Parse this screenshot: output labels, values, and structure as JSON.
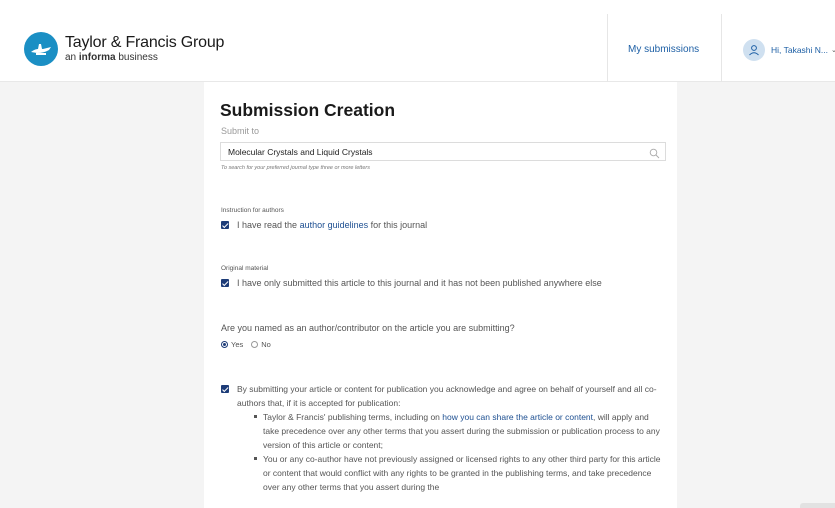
{
  "header": {
    "brand_name": "Taylor & Francis Group",
    "brand_sub_prefix": "an",
    "brand_sub_bold": "informa",
    "brand_sub_suffix": "business",
    "my_submissions": "My submissions",
    "user_greeting": "Hi, Takashi N...",
    "user_chevron": "⌄"
  },
  "form": {
    "title": "Submission Creation",
    "submit_to_label": "Submit to",
    "journal_value": "Molecular Crystals and Liquid Crystals",
    "journal_hint": "To search for your preferred journal type three or more letters",
    "instructions_label": "Instruction for authors",
    "guidelines_pre": "I have read the",
    "guidelines_link": "author guidelines",
    "guidelines_post": "for this journal",
    "original_label": "Original material",
    "original_text": "I have only submitted this article to this journal and it has not been published anywhere else",
    "author_question": "Are you named as an author/contributor on the article you are submitting?",
    "author_options": [
      "Yes",
      "No"
    ],
    "author_selected": "Yes",
    "consent_main": "By submitting your article or content for publication you acknowledge and agree on behalf of yourself and all co-authors that, if it is accepted for publication:",
    "bullet1_pre": "Taylor & Francis' publishing terms, including on",
    "bullet1_link": "how you can share the article or content",
    "bullet1_post": ", will apply and take precedence over any other terms that you assert during the submission or publication process to any version of this article or content;",
    "bullet2": "You or any co-author have not previously assigned or licensed rights to any other third party for this article or content that would conflict with any rights to be granted in the publishing terms, and take precedence over any other terms that you assert during the"
  },
  "icons": {
    "logo": "taylor-francis-lamp-logo",
    "search": "search-icon",
    "user": "user-icon"
  },
  "colors": {
    "brand_blue": "#1b8fc4",
    "link_blue": "#1d5fa5",
    "checkbox": "#1d3c78"
  }
}
